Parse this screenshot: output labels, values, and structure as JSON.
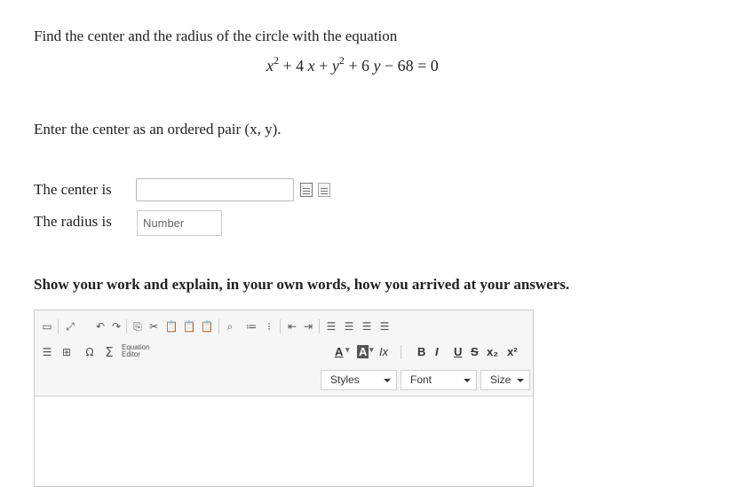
{
  "question": {
    "prompt": "Find the center and the radius of the circle with the equation",
    "equation": {
      "x_var": "x",
      "x_exp": "2",
      "x_term": " + 4 ",
      "x_var2": "x",
      "plus_y": " + ",
      "y_var": "y",
      "y_exp": "2",
      "y_term": " + 6 ",
      "y_var2": "y",
      "rest": "  −  68 = 0"
    },
    "instruction": "Enter the center as an ordered pair (x, y)."
  },
  "answers": {
    "center_label": "The center is",
    "center_value": "",
    "radius_label": "The radius is",
    "radius_placeholder": "Number",
    "radius_value": ""
  },
  "work_prompt": "Show your work and explain, in your own words, how you arrived at your answers.",
  "editor": {
    "equation_editor_label_1": "Equation",
    "equation_editor_label_2": "Editor",
    "format_labels": {
      "font_color": "A",
      "bg_color": "A",
      "remove_format": "Ix",
      "bold": "B",
      "italic": "I",
      "underline": "U",
      "strike": "S",
      "subscript": "x₂",
      "superscript": "x²"
    },
    "styles_label": "Styles",
    "font_label": "Font",
    "size_label": "Size"
  }
}
